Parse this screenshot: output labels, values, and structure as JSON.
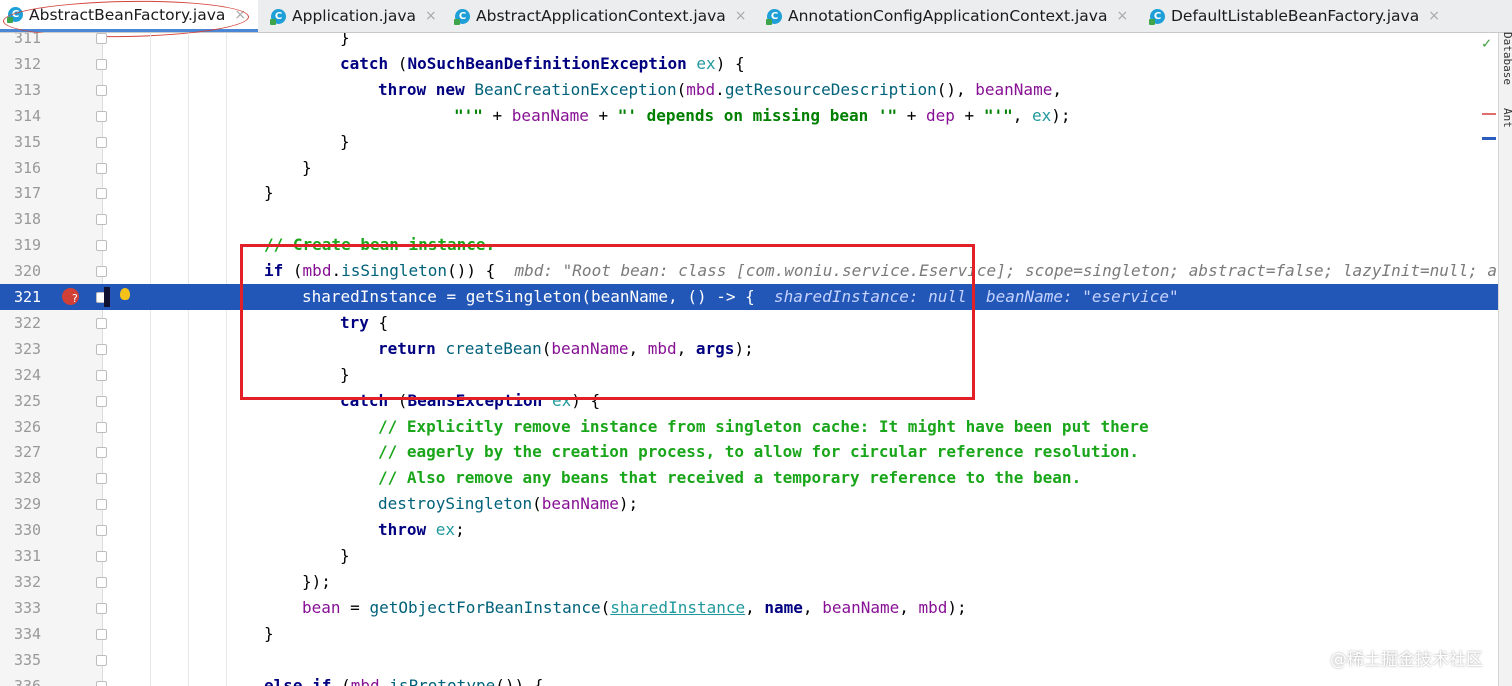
{
  "tabs": [
    {
      "label": "AbstractBeanFactory.java",
      "active": true
    },
    {
      "label": "Application.java"
    },
    {
      "label": "AbstractApplicationContext.java"
    },
    {
      "label": "AnnotationConfigApplicationContext.java"
    },
    {
      "label": "DefaultListableBeanFactory.java"
    }
  ],
  "close_glyph": "×",
  "tab_icon": "C",
  "right_panel": {
    "database": "Database",
    "ant": "Ant"
  },
  "watermark": "@稀土掘金技术社区",
  "lines": [
    {
      "n": "311",
      "t": [
        {
          "c": "}",
          "k": ""
        }
      ]
    },
    {
      "n": "312",
      "t": [
        {
          "c": "catch ",
          "k": "kw"
        },
        {
          "c": "(",
          "k": ""
        },
        {
          "c": "NoSuchBeanDefinitionException ",
          "k": "cls-b"
        },
        {
          "c": "ex",
          "k": "cls"
        },
        {
          "c": ") {",
          "k": ""
        }
      ]
    },
    {
      "n": "313",
      "t": [
        {
          "c": "throw new ",
          "k": "kw"
        },
        {
          "c": "BeanCreationException",
          "k": "fn-c"
        },
        {
          "c": "(",
          "k": ""
        },
        {
          "c": "mbd",
          "k": "lv"
        },
        {
          "c": ".",
          "k": ""
        },
        {
          "c": "getResourceDescription",
          "k": "fn-c"
        },
        {
          "c": "(), ",
          "k": ""
        },
        {
          "c": "beanName",
          "k": "lv"
        },
        {
          "c": ",",
          "k": ""
        }
      ]
    },
    {
      "n": "314",
      "t": [
        {
          "c": "\"'\" ",
          "k": "str"
        },
        {
          "c": "+ ",
          "k": ""
        },
        {
          "c": "beanName ",
          "k": "lv"
        },
        {
          "c": "+ ",
          "k": ""
        },
        {
          "c": "\"' depends on missing bean '\" ",
          "k": "str"
        },
        {
          "c": "+ ",
          "k": ""
        },
        {
          "c": "dep ",
          "k": "lv"
        },
        {
          "c": "+ ",
          "k": ""
        },
        {
          "c": "\"'\"",
          "k": "str"
        },
        {
          "c": ", ",
          "k": ""
        },
        {
          "c": "ex",
          "k": "cls"
        },
        {
          "c": ");",
          "k": ""
        }
      ]
    },
    {
      "n": "315",
      "t": [
        {
          "c": "}",
          "k": ""
        }
      ]
    },
    {
      "n": "316",
      "t": [
        {
          "c": "}",
          "k": ""
        }
      ]
    },
    {
      "n": "317",
      "t": [
        {
          "c": "}",
          "k": ""
        }
      ]
    },
    {
      "n": "318",
      "t": []
    },
    {
      "n": "319",
      "t": [
        {
          "c": "// Create bean instance.",
          "k": "cmt2"
        }
      ]
    },
    {
      "n": "320",
      "t": [
        {
          "c": "if ",
          "k": "kw"
        },
        {
          "c": "(",
          "k": ""
        },
        {
          "c": "mbd",
          "k": "lv"
        },
        {
          "c": ".",
          "k": ""
        },
        {
          "c": "isSingleton",
          "k": "fn-c"
        },
        {
          "c": "()) {  ",
          "k": ""
        },
        {
          "c": "mbd: \"Root bean: class [com.woniu.service.Eservice]; scope=singleton; abstract=false; lazyInit=null; au",
          "k": "hint"
        }
      ]
    },
    {
      "n": "321",
      "t": [
        {
          "c": "sharedInstance ",
          "k": ""
        },
        {
          "c": "= getSingleton(beanName, () -> {  ",
          "k": ""
        },
        {
          "c": "sharedInstance: null  beanName: \"eservice\"",
          "k": "hint"
        }
      ]
    },
    {
      "n": "322",
      "t": [
        {
          "c": "try ",
          "k": "kw"
        },
        {
          "c": "{",
          "k": ""
        }
      ]
    },
    {
      "n": "323",
      "t": [
        {
          "c": "return ",
          "k": "kw"
        },
        {
          "c": "createBean",
          "k": "fn-c"
        },
        {
          "c": "(",
          "k": ""
        },
        {
          "c": "beanName",
          "k": "lv"
        },
        {
          "c": ", ",
          "k": ""
        },
        {
          "c": "mbd",
          "k": "lv"
        },
        {
          "c": ", ",
          "k": ""
        },
        {
          "c": "args",
          "k": "kw"
        },
        {
          "c": ");",
          "k": ""
        }
      ]
    },
    {
      "n": "324",
      "t": [
        {
          "c": "}",
          "k": ""
        }
      ]
    },
    {
      "n": "325",
      "t": [
        {
          "c": "catch ",
          "k": "kw"
        },
        {
          "c": "(",
          "k": ""
        },
        {
          "c": "BeansException ",
          "k": "cls-b"
        },
        {
          "c": "ex",
          "k": "cls"
        },
        {
          "c": ") {",
          "k": ""
        }
      ]
    },
    {
      "n": "326",
      "t": [
        {
          "c": "// Explicitly remove instance from singleton cache: It might have been put there",
          "k": "cmt2"
        }
      ]
    },
    {
      "n": "327",
      "t": [
        {
          "c": "// eagerly by the creation process, to allow for circular reference resolution.",
          "k": "cmt2"
        }
      ]
    },
    {
      "n": "328",
      "t": [
        {
          "c": "// Also remove any beans that received a temporary reference to the bean.",
          "k": "cmt2"
        }
      ]
    },
    {
      "n": "329",
      "t": [
        {
          "c": "destroySingleton",
          "k": "fn-c"
        },
        {
          "c": "(",
          "k": ""
        },
        {
          "c": "beanName",
          "k": "lv"
        },
        {
          "c": ");",
          "k": ""
        }
      ]
    },
    {
      "n": "330",
      "t": [
        {
          "c": "throw ",
          "k": "kw"
        },
        {
          "c": "ex",
          "k": "cls"
        },
        {
          "c": ";",
          "k": ""
        }
      ]
    },
    {
      "n": "331",
      "t": [
        {
          "c": "}",
          "k": ""
        }
      ]
    },
    {
      "n": "332",
      "t": [
        {
          "c": "});",
          "k": ""
        }
      ]
    },
    {
      "n": "333",
      "t": [
        {
          "c": "bean ",
          "k": "lv"
        },
        {
          "c": "= ",
          "k": ""
        },
        {
          "c": "getObjectForBeanInstance",
          "k": "fn-c"
        },
        {
          "c": "(",
          "k": ""
        },
        {
          "c": "sharedInstance",
          "k": "field-ul"
        },
        {
          "c": ", ",
          "k": ""
        },
        {
          "c": "name",
          "k": "kw"
        },
        {
          "c": ", ",
          "k": ""
        },
        {
          "c": "beanName",
          "k": "lv"
        },
        {
          "c": ", ",
          "k": ""
        },
        {
          "c": "mbd",
          "k": "lv"
        },
        {
          "c": ");",
          "k": ""
        }
      ]
    },
    {
      "n": "334",
      "t": [
        {
          "c": "}",
          "k": ""
        }
      ]
    },
    {
      "n": "335",
      "t": []
    },
    {
      "n": "336",
      "t": [
        {
          "c": "else if ",
          "k": "kw"
        },
        {
          "c": "(",
          "k": ""
        },
        {
          "c": "mbd",
          "k": "lv"
        },
        {
          "c": ".",
          "k": ""
        },
        {
          "c": "isPrototype",
          "k": "fn-c"
        },
        {
          "c": "()) {",
          "k": ""
        }
      ]
    }
  ],
  "highlight_line": "321",
  "colors": {
    "selection": "#2256b7",
    "redbox": "#e12027",
    "accent": "#4a87d6"
  }
}
